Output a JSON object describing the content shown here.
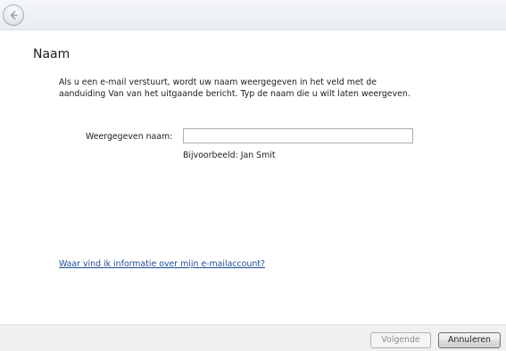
{
  "nav": {
    "back_icon": "back-arrow-icon"
  },
  "page": {
    "title": "Naam",
    "intro": "Als u een e-mail verstuurt, wordt uw naam weergegeven in het veld met de aanduiding Van van het uitgaande bericht. Typ de naam die u wilt laten weergeven.",
    "field_label": "Weergegeven naam:",
    "field_value": "",
    "example": "Bijvoorbeeld: Jan Smit",
    "help_link": "Waar vind ik informatie over mijn e-mailaccount?"
  },
  "footer": {
    "next_label": "Volgende",
    "next_enabled": false,
    "cancel_label": "Annuleren"
  }
}
